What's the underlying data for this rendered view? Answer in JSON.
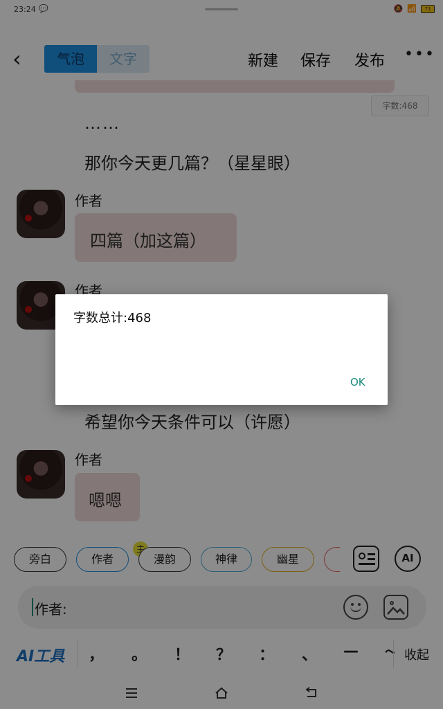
{
  "status": {
    "time": "23:24",
    "battery": "71"
  },
  "header": {
    "tab_bubble": "气泡",
    "tab_text": "文字",
    "new_label": "新建",
    "save_label": "保存",
    "publish_label": "发布",
    "more_label": "•••"
  },
  "chat": {
    "counter": "字数:468",
    "ellipsis": "……",
    "line1": "那你今天更几篇？（星星眼）",
    "msg1_author": "作者",
    "msg1_text": "四篇（加这篇）",
    "msg2_author": "作者",
    "line2": "希望你今天条件可以（许愿）",
    "msg3_author": "作者",
    "msg3_text": "嗯嗯"
  },
  "chips": {
    "narration": "旁白",
    "author": "作者",
    "main_badge": "主",
    "c3": "漫韵",
    "c4": "神律",
    "c5": "幽星",
    "ai": "AI"
  },
  "input": {
    "value": "作者:"
  },
  "toolbar": {
    "ai_tools": "AI工具",
    "punct": [
      "，",
      "。",
      "！",
      "？",
      "：",
      "、",
      "—",
      "～"
    ],
    "collapse": "收起"
  },
  "dialog": {
    "message": "字数总计:468",
    "ok_label": "OK"
  },
  "colors": {
    "accent": "#1e8fe0",
    "bubble": "#f1d9d9",
    "ok": "#1a8a7a"
  }
}
